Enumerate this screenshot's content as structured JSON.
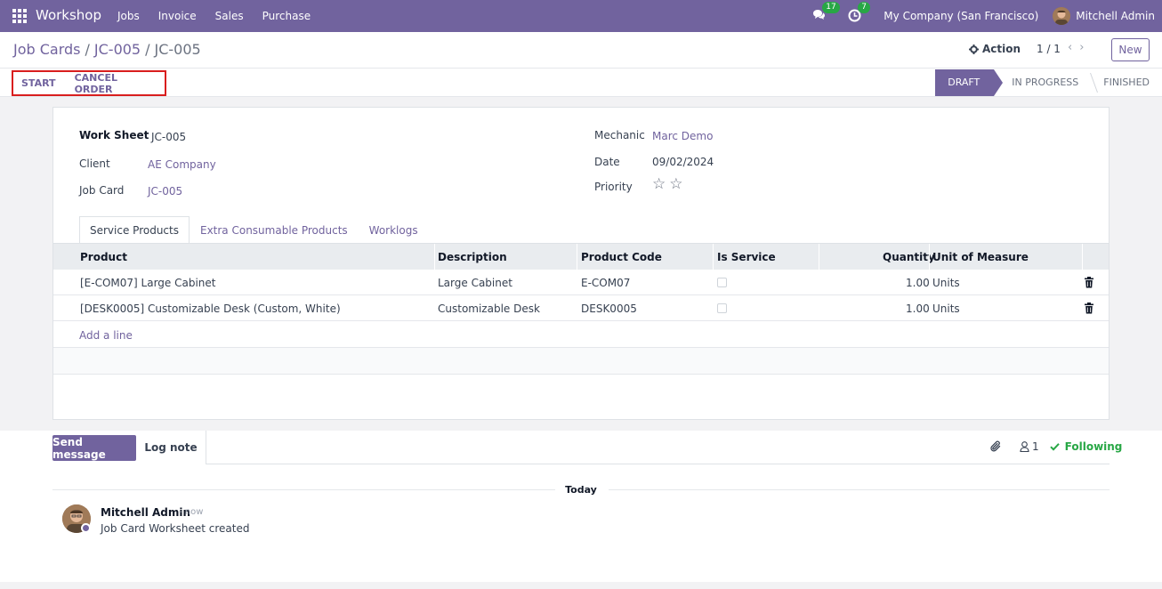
{
  "navbar": {
    "app_name": "Workshop",
    "menu": [
      "Jobs",
      "Invoice",
      "Sales",
      "Purchase"
    ],
    "messages_count": "17",
    "activities_count": "7",
    "company": "My Company (San Francisco)",
    "user": "Mitchell Admin"
  },
  "control_panel": {
    "breadcrumb": [
      "Job Cards",
      "JC-005",
      "JC-005"
    ],
    "action_label": "Action",
    "pager": "1 / 1",
    "new_label": "New"
  },
  "statusbar": {
    "buttons": [
      "START",
      "CANCEL ORDER"
    ],
    "stages": [
      "DRAFT",
      "IN PROGRESS",
      "FINISHED"
    ],
    "active_stage": "DRAFT"
  },
  "form": {
    "work_sheet_label": "Work Sheet",
    "work_sheet_value": "JC-005",
    "client_label": "Client",
    "client_value": "AE Company",
    "job_card_label": "Job Card",
    "job_card_value": "JC-005",
    "mechanic_label": "Mechanic",
    "mechanic_value": "Marc Demo",
    "date_label": "Date",
    "date_value": "09/02/2024",
    "priority_label": "Priority",
    "priority_stars": 0
  },
  "tabs": [
    "Service Products",
    "Extra Consumable Products",
    "Worklogs"
  ],
  "table": {
    "headers": [
      "Product",
      "Description",
      "Product Code",
      "Is Service",
      "Quantity",
      "Unit of Measure"
    ],
    "rows": [
      {
        "product": "[E-COM07] Large Cabinet",
        "description": "Large Cabinet",
        "code": "E-COM07",
        "quantity": "1.00",
        "uom": "Units"
      },
      {
        "product": "[DESK0005] Customizable Desk (Custom, White)",
        "description": "Customizable Desk",
        "code": "DESK0005",
        "quantity": "1.00",
        "uom": "Units"
      }
    ],
    "add_line": "Add a line"
  },
  "chatter": {
    "send_message": "Send message",
    "log_note": "Log note",
    "followers_count": "1",
    "following_label": "Following",
    "today_label": "Today",
    "message": {
      "author": "Mitchell Admin",
      "time": "- now",
      "body": "Job Card Worksheet created"
    }
  },
  "colors": {
    "brand": "#71639e",
    "highlight_border": "#d91e1e",
    "following": "#28a745"
  }
}
